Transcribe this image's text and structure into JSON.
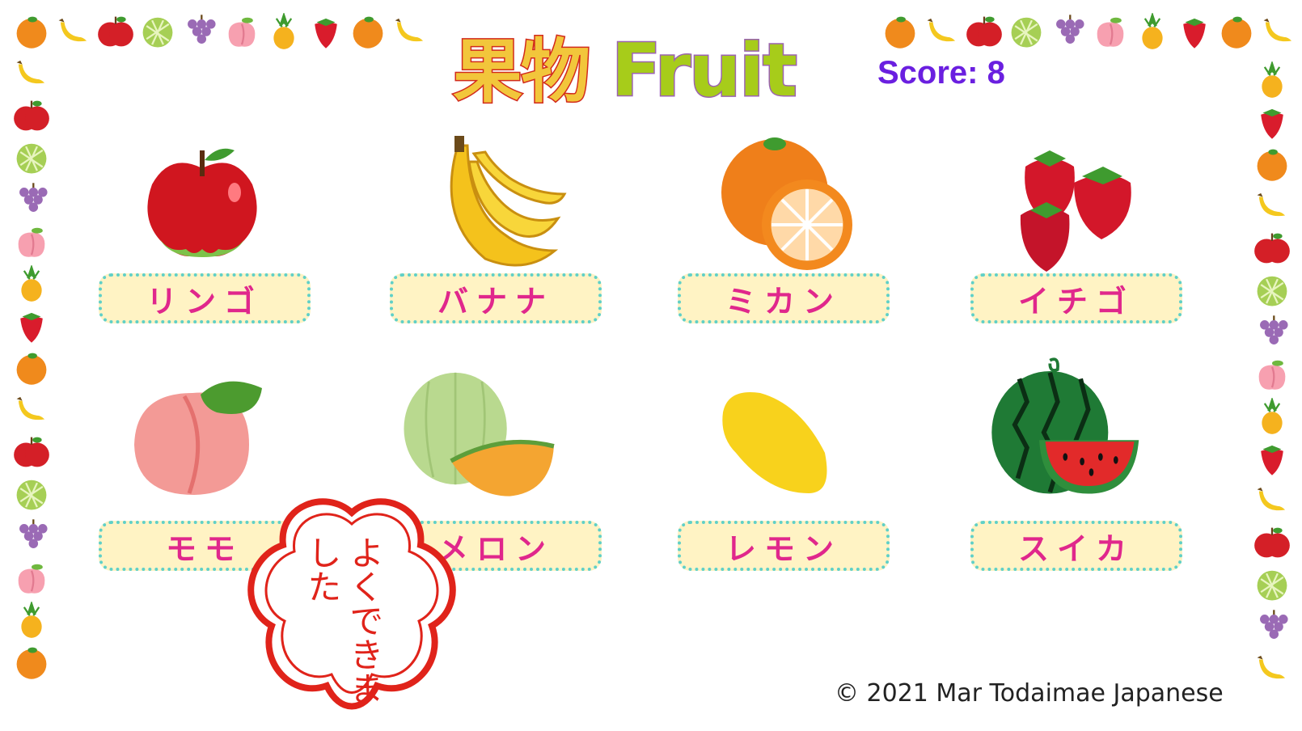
{
  "title": {
    "jp": "果物",
    "en": "Fruit"
  },
  "score": "Score: 8",
  "fruits": [
    {
      "icon": "apple-icon",
      "label": "リンゴ"
    },
    {
      "icon": "banana-icon",
      "label": "バナナ"
    },
    {
      "icon": "mikan-icon",
      "label": "ミカン"
    },
    {
      "icon": "strawberry-icon",
      "label": "イチゴ"
    },
    {
      "icon": "peach-icon",
      "label": "モモ"
    },
    {
      "icon": "melon-icon",
      "label": "メロン"
    },
    {
      "icon": "lemon-icon",
      "label": "レモン"
    },
    {
      "icon": "watermelon-icon",
      "label": "スイカ"
    }
  ],
  "stamp": {
    "text": "よくできました"
  },
  "footer": {
    "copyright": "© 2021 Mar Todaimae Japanese"
  },
  "colors": {
    "label_text": "#e0278c",
    "label_bg": "#fff3c4",
    "label_border": "#5fd0c8",
    "score": "#6a1fe0",
    "stamp": "#e0231a"
  }
}
